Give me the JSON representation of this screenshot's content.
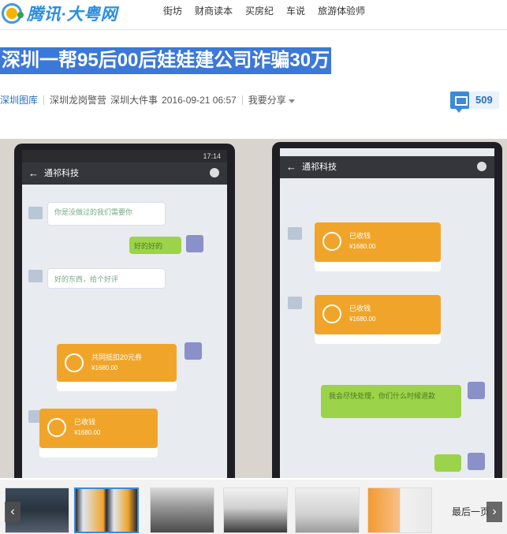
{
  "header": {
    "logo_text": "腾讯·大粤网",
    "nav": [
      "街坊",
      "财商读本",
      "买房纪",
      "车说",
      "旅游体验师"
    ]
  },
  "article": {
    "title": "深圳一帮95后00后娃娃建公司诈骗30万",
    "source": "深圳图库",
    "tags": "深圳龙岗警营",
    "category": "深圳大件事",
    "datetime": "2016-09-21 06:57",
    "share_label": "我要分享",
    "comment_count": "509"
  },
  "photo": {
    "left_phone": {
      "status_time": "17:14",
      "chat_title": "通祁科技",
      "messages": [
        {
          "kind": "white",
          "text": "你是没做过的我们需要你"
        },
        {
          "kind": "green",
          "text": "好的好的"
        },
        {
          "kind": "white",
          "text": "好的东西，给个好评"
        },
        {
          "kind": "orange",
          "text": "共同抵扣20元券",
          "amount": "¥1680.00"
        },
        {
          "kind": "orange",
          "text": "已收钱",
          "amount": "¥1680.00"
        }
      ]
    },
    "right_phone": {
      "chat_title": "通祁科技",
      "messages": [
        {
          "kind": "orange",
          "text": "已收钱",
          "amount": "¥1680.00"
        },
        {
          "kind": "orange",
          "text": "已收钱",
          "amount": "¥1680.00"
        },
        {
          "kind": "green",
          "text": "我会尽快处理，你们什么时候退款"
        }
      ]
    }
  },
  "strip": {
    "prev_label": "‹",
    "next_label": "›",
    "last_page_label": "最后一页"
  },
  "colors": {
    "accent": "#3b78d8",
    "link": "#2a6ebb",
    "orange": "#f0a52a",
    "green": "#9bd34a"
  }
}
